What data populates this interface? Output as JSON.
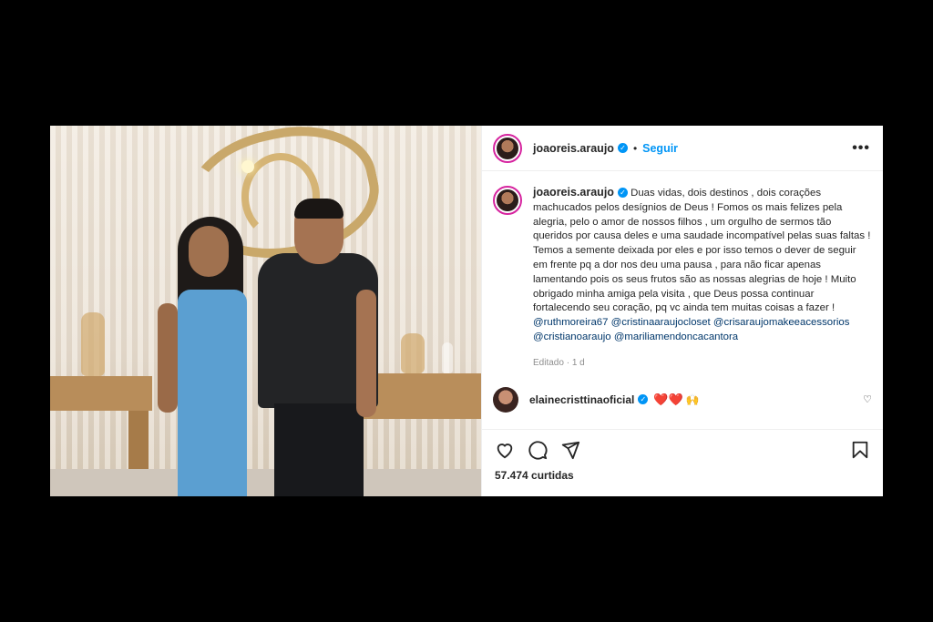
{
  "post": {
    "author": "joaoreis.araujo",
    "follow_label": "Seguir",
    "separator": "•",
    "more_label": "•••",
    "caption_text": "Duas vidas, dois destinos , dois corações machucados pelos desígnios de Deus ! Fomos os mais felizes pela alegria, pelo o amor de nossos filhos , um orgulho de sermos tão queridos por causa deles e uma saudade incompatível pelas suas faltas ! Temos a semente deixada por eles e por isso temos o dever de seguir em frente pq a dor nos deu uma pausa , para não ficar apenas lamentando pois os seus frutos são as nossas alegrias de hoje ! Muito obrigado minha amiga pela visita , que Deus possa continuar fortalecendo seu coração, pq vc ainda tem muitas coisas a fazer !",
    "mentions": [
      "@ruthmoreira67",
      "@cristinaaraujocloset",
      "@crisaraujomakeeacessorios",
      "@cristianoaraujo",
      "@mariliamendoncacantora"
    ],
    "edited_label": "Editado",
    "time_ago": "1 d",
    "likes_label": "57.474 curtidas"
  },
  "comment": {
    "username": "elainecristtinaoficial",
    "hearts": "❤️❤️",
    "emoji": "🙌"
  },
  "icons": {
    "verified": "verified-badge-icon",
    "like": "heart-icon",
    "comment": "comment-icon",
    "share": "send-icon",
    "save": "bookmark-icon"
  },
  "colors": {
    "accent": "#0095f6",
    "mention": "#00376b",
    "muted": "#8e8e8e"
  }
}
